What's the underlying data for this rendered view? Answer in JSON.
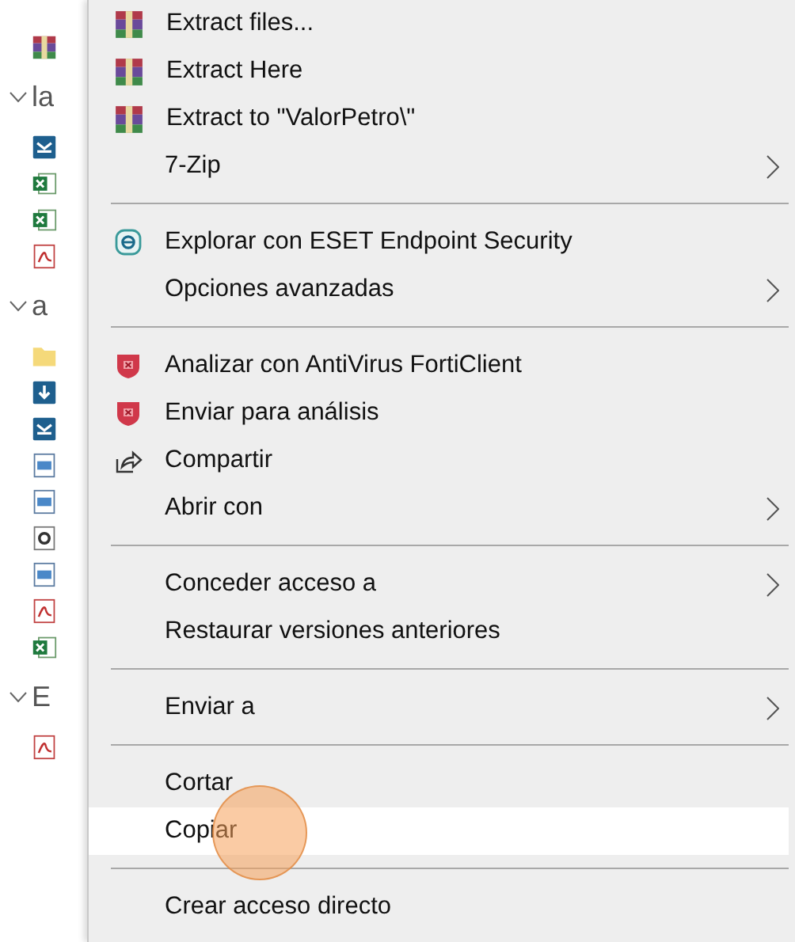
{
  "explorer": {
    "rows": [
      {
        "kind": "archive"
      },
      {
        "kind": "header",
        "label": "la"
      },
      {
        "kind": "mail"
      },
      {
        "kind": "sheet"
      },
      {
        "kind": "sheet"
      },
      {
        "kind": "pdf"
      },
      {
        "kind": "header",
        "label": "a"
      },
      {
        "kind": "folder"
      },
      {
        "kind": "download"
      },
      {
        "kind": "mail"
      },
      {
        "kind": "image"
      },
      {
        "kind": "image"
      },
      {
        "kind": "doc"
      },
      {
        "kind": "image"
      },
      {
        "kind": "pdf"
      },
      {
        "kind": "sheet"
      },
      {
        "kind": "header",
        "label": "E"
      },
      {
        "kind": "pdf"
      }
    ]
  },
  "menu": {
    "groups": [
      {
        "items": [
          {
            "label": "Extract files...",
            "kind": "archive",
            "submenu": false,
            "selected": false
          },
          {
            "label": "Extract Here",
            "kind": "archive",
            "submenu": false,
            "selected": false
          },
          {
            "label": "Extract to \"ValorPetro\\\"",
            "kind": "archive",
            "submenu": false,
            "selected": false
          },
          {
            "label": "7-Zip",
            "kind": "plain",
            "submenu": true,
            "selected": false
          }
        ]
      },
      {
        "items": [
          {
            "label": "Explorar con ESET Endpoint Security",
            "kind": "scan",
            "submenu": false,
            "selected": false
          },
          {
            "label": "Opciones avanzadas",
            "kind": "plain",
            "submenu": true,
            "selected": false
          }
        ]
      },
      {
        "items": [
          {
            "label": "Analizar con AntiVirus FortiClient",
            "kind": "shield",
            "submenu": false,
            "selected": false
          },
          {
            "label": "Enviar para análisis",
            "kind": "shield",
            "submenu": false,
            "selected": false
          },
          {
            "label": "Compartir",
            "kind": "share",
            "submenu": false,
            "selected": false
          },
          {
            "label": "Abrir con",
            "kind": "plain",
            "submenu": true,
            "selected": false
          }
        ]
      },
      {
        "items": [
          {
            "label": "Conceder acceso a",
            "kind": "plain",
            "submenu": true,
            "selected": false
          },
          {
            "label": "Restaurar versiones anteriores",
            "kind": "plain",
            "submenu": false,
            "selected": false
          }
        ]
      },
      {
        "items": [
          {
            "label": "Enviar a",
            "kind": "plain",
            "submenu": true,
            "selected": false
          }
        ]
      },
      {
        "items": [
          {
            "label": "Cortar",
            "kind": "plain",
            "submenu": false,
            "selected": false
          },
          {
            "label": "Copiar",
            "kind": "plain",
            "submenu": false,
            "selected": true
          }
        ]
      },
      {
        "items": [
          {
            "label": "Crear acceso directo",
            "kind": "plain",
            "submenu": false,
            "selected": false
          }
        ]
      }
    ]
  }
}
